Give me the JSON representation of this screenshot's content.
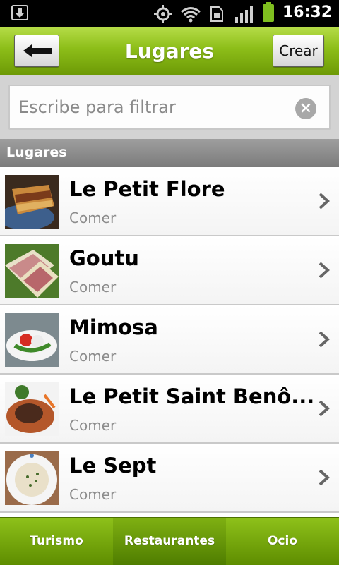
{
  "status_bar": {
    "time": "16:32"
  },
  "header": {
    "title": "Lugares",
    "create_label": "Crear"
  },
  "search": {
    "placeholder": "Escribe para filtrar"
  },
  "section": {
    "label": "Lugares"
  },
  "places": [
    {
      "name": "Le Petit Flore",
      "category": "Comer"
    },
    {
      "name": "Goutu",
      "category": "Comer"
    },
    {
      "name": "Mimosa",
      "category": "Comer"
    },
    {
      "name": "Le Petit Saint Benô...",
      "category": "Comer"
    },
    {
      "name": "Le Sept",
      "category": "Comer"
    }
  ],
  "tabs": [
    {
      "label": "Turismo",
      "active": false
    },
    {
      "label": "Restaurantes",
      "active": true
    },
    {
      "label": "Ocio",
      "active": false
    }
  ],
  "colors": {
    "accent_green": "#8dbe19",
    "dark_green": "#5e8d00"
  }
}
